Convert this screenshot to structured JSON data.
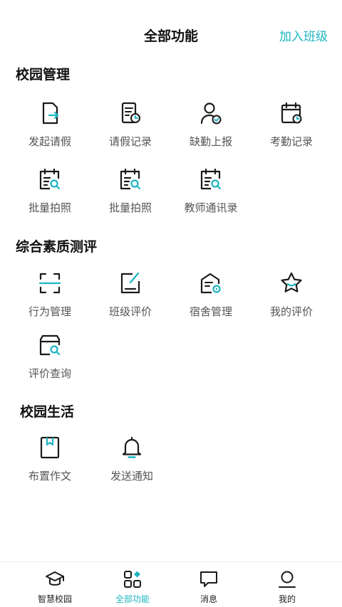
{
  "status_bar": {
    "ghost_text": ""
  },
  "header": {
    "title": "全部功能",
    "join_label": "加入班级"
  },
  "sections": {
    "campus_management": {
      "title": "校园管理",
      "items": [
        {
          "label": "发起请假",
          "icon": "leave-request-icon"
        },
        {
          "label": "请假记录",
          "icon": "leave-record-icon"
        },
        {
          "label": "缺勤上报",
          "icon": "absence-report-icon"
        },
        {
          "label": "考勤记录",
          "icon": "attendance-record-icon"
        },
        {
          "label": "批量拍照",
          "icon": "batch-photo-icon"
        },
        {
          "label": "批量拍照",
          "icon": "batch-photo-icon"
        },
        {
          "label": "教师通讯录",
          "icon": "teacher-directory-icon"
        }
      ]
    },
    "quality_evaluation": {
      "title": "综合素质测评",
      "items": [
        {
          "label": "行为管理",
          "icon": "behavior-scan-icon"
        },
        {
          "label": "班级评价",
          "icon": "class-evaluation-icon"
        },
        {
          "label": "宿舍管理",
          "icon": "dorm-management-icon"
        },
        {
          "label": "我的评价",
          "icon": "star-icon"
        },
        {
          "label": "评价查询",
          "icon": "evaluation-search-icon"
        }
      ]
    },
    "campus_life": {
      "title": "校园生活",
      "items": [
        {
          "label": "布置作文",
          "icon": "bookmark-book-icon"
        },
        {
          "label": "发送通知",
          "icon": "bell-icon"
        }
      ]
    }
  },
  "tabbar": {
    "tabs": [
      {
        "label": "智慧校园",
        "icon": "graduation-cap-icon",
        "active": false
      },
      {
        "label": "全部功能",
        "icon": "apps-grid-icon",
        "active": true
      },
      {
        "label": "消息",
        "icon": "chat-bubble-icon",
        "active": false
      },
      {
        "label": "我的",
        "icon": "user-icon",
        "active": false
      }
    ]
  },
  "colors": {
    "accent": "#1cb5c2",
    "icon_stroke": "#1a1a1a",
    "label": "#555555"
  }
}
